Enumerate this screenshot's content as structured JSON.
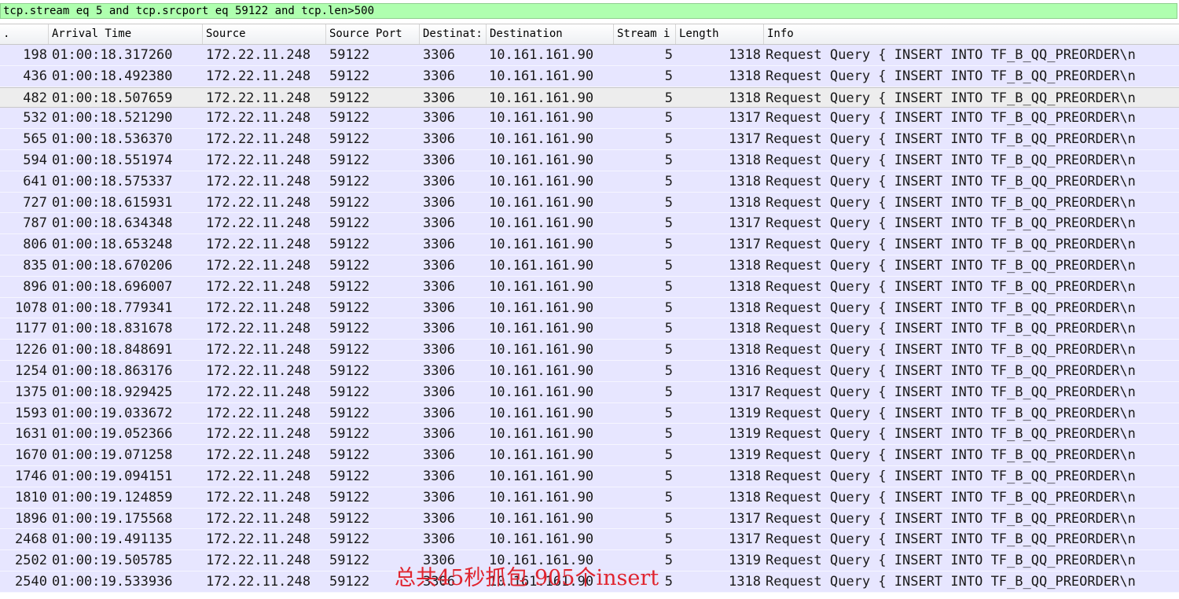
{
  "filter": {
    "text": "tcp.stream eq 5 and tcp.srcport eq 59122 and tcp.len>500"
  },
  "columns": {
    "no": ".",
    "time": "Arrival Time",
    "source": "Source",
    "source_port": "Source Port",
    "dest_port": "Destinat:",
    "destination": "Destination",
    "stream": "Stream i",
    "length": "Length",
    "info": "Info"
  },
  "selected_row_index": 2,
  "rows": [
    {
      "no": "198",
      "time": "01:00:18.317260",
      "src": "172.22.11.248",
      "sport": "59122",
      "dport": "3306",
      "dst": "10.161.161.90",
      "stream": "5",
      "len": "1318",
      "info": "Request Query { INSERT INTO TF_B_QQ_PREORDER\\n"
    },
    {
      "no": "436",
      "time": "01:00:18.492380",
      "src": "172.22.11.248",
      "sport": "59122",
      "dport": "3306",
      "dst": "10.161.161.90",
      "stream": "5",
      "len": "1318",
      "info": "Request Query { INSERT INTO TF_B_QQ_PREORDER\\n"
    },
    {
      "no": "482",
      "time": "01:00:18.507659",
      "src": "172.22.11.248",
      "sport": "59122",
      "dport": "3306",
      "dst": "10.161.161.90",
      "stream": "5",
      "len": "1318",
      "info": "Request Query { INSERT INTO TF_B_QQ_PREORDER\\n"
    },
    {
      "no": "532",
      "time": "01:00:18.521290",
      "src": "172.22.11.248",
      "sport": "59122",
      "dport": "3306",
      "dst": "10.161.161.90",
      "stream": "5",
      "len": "1317",
      "info": "Request Query { INSERT INTO TF_B_QQ_PREORDER\\n"
    },
    {
      "no": "565",
      "time": "01:00:18.536370",
      "src": "172.22.11.248",
      "sport": "59122",
      "dport": "3306",
      "dst": "10.161.161.90",
      "stream": "5",
      "len": "1317",
      "info": "Request Query { INSERT INTO TF_B_QQ_PREORDER\\n"
    },
    {
      "no": "594",
      "time": "01:00:18.551974",
      "src": "172.22.11.248",
      "sport": "59122",
      "dport": "3306",
      "dst": "10.161.161.90",
      "stream": "5",
      "len": "1318",
      "info": "Request Query { INSERT INTO TF_B_QQ_PREORDER\\n"
    },
    {
      "no": "641",
      "time": "01:00:18.575337",
      "src": "172.22.11.248",
      "sport": "59122",
      "dport": "3306",
      "dst": "10.161.161.90",
      "stream": "5",
      "len": "1318",
      "info": "Request Query { INSERT INTO TF_B_QQ_PREORDER\\n"
    },
    {
      "no": "727",
      "time": "01:00:18.615931",
      "src": "172.22.11.248",
      "sport": "59122",
      "dport": "3306",
      "dst": "10.161.161.90",
      "stream": "5",
      "len": "1318",
      "info": "Request Query { INSERT INTO TF_B_QQ_PREORDER\\n"
    },
    {
      "no": "787",
      "time": "01:00:18.634348",
      "src": "172.22.11.248",
      "sport": "59122",
      "dport": "3306",
      "dst": "10.161.161.90",
      "stream": "5",
      "len": "1317",
      "info": "Request Query { INSERT INTO TF_B_QQ_PREORDER\\n"
    },
    {
      "no": "806",
      "time": "01:00:18.653248",
      "src": "172.22.11.248",
      "sport": "59122",
      "dport": "3306",
      "dst": "10.161.161.90",
      "stream": "5",
      "len": "1317",
      "info": "Request Query { INSERT INTO TF_B_QQ_PREORDER\\n"
    },
    {
      "no": "835",
      "time": "01:00:18.670206",
      "src": "172.22.11.248",
      "sport": "59122",
      "dport": "3306",
      "dst": "10.161.161.90",
      "stream": "5",
      "len": "1318",
      "info": "Request Query { INSERT INTO TF_B_QQ_PREORDER\\n"
    },
    {
      "no": "896",
      "time": "01:00:18.696007",
      "src": "172.22.11.248",
      "sport": "59122",
      "dport": "3306",
      "dst": "10.161.161.90",
      "stream": "5",
      "len": "1318",
      "info": "Request Query { INSERT INTO TF_B_QQ_PREORDER\\n"
    },
    {
      "no": "1078",
      "time": "01:00:18.779341",
      "src": "172.22.11.248",
      "sport": "59122",
      "dport": "3306",
      "dst": "10.161.161.90",
      "stream": "5",
      "len": "1318",
      "info": "Request Query { INSERT INTO TF_B_QQ_PREORDER\\n"
    },
    {
      "no": "1177",
      "time": "01:00:18.831678",
      "src": "172.22.11.248",
      "sport": "59122",
      "dport": "3306",
      "dst": "10.161.161.90",
      "stream": "5",
      "len": "1318",
      "info": "Request Query { INSERT INTO TF_B_QQ_PREORDER\\n"
    },
    {
      "no": "1226",
      "time": "01:00:18.848691",
      "src": "172.22.11.248",
      "sport": "59122",
      "dport": "3306",
      "dst": "10.161.161.90",
      "stream": "5",
      "len": "1318",
      "info": "Request Query { INSERT INTO TF_B_QQ_PREORDER\\n"
    },
    {
      "no": "1254",
      "time": "01:00:18.863176",
      "src": "172.22.11.248",
      "sport": "59122",
      "dport": "3306",
      "dst": "10.161.161.90",
      "stream": "5",
      "len": "1316",
      "info": "Request Query { INSERT INTO TF_B_QQ_PREORDER\\n"
    },
    {
      "no": "1375",
      "time": "01:00:18.929425",
      "src": "172.22.11.248",
      "sport": "59122",
      "dport": "3306",
      "dst": "10.161.161.90",
      "stream": "5",
      "len": "1317",
      "info": "Request Query { INSERT INTO TF_B_QQ_PREORDER\\n"
    },
    {
      "no": "1593",
      "time": "01:00:19.033672",
      "src": "172.22.11.248",
      "sport": "59122",
      "dport": "3306",
      "dst": "10.161.161.90",
      "stream": "5",
      "len": "1319",
      "info": "Request Query { INSERT INTO TF_B_QQ_PREORDER\\n"
    },
    {
      "no": "1631",
      "time": "01:00:19.052366",
      "src": "172.22.11.248",
      "sport": "59122",
      "dport": "3306",
      "dst": "10.161.161.90",
      "stream": "5",
      "len": "1319",
      "info": "Request Query { INSERT INTO TF_B_QQ_PREORDER\\n"
    },
    {
      "no": "1670",
      "time": "01:00:19.071258",
      "src": "172.22.11.248",
      "sport": "59122",
      "dport": "3306",
      "dst": "10.161.161.90",
      "stream": "5",
      "len": "1319",
      "info": "Request Query { INSERT INTO TF_B_QQ_PREORDER\\n"
    },
    {
      "no": "1746",
      "time": "01:00:19.094151",
      "src": "172.22.11.248",
      "sport": "59122",
      "dport": "3306",
      "dst": "10.161.161.90",
      "stream": "5",
      "len": "1318",
      "info": "Request Query { INSERT INTO TF_B_QQ_PREORDER\\n"
    },
    {
      "no": "1810",
      "time": "01:00:19.124859",
      "src": "172.22.11.248",
      "sport": "59122",
      "dport": "3306",
      "dst": "10.161.161.90",
      "stream": "5",
      "len": "1318",
      "info": "Request Query { INSERT INTO TF_B_QQ_PREORDER\\n"
    },
    {
      "no": "1896",
      "time": "01:00:19.175568",
      "src": "172.22.11.248",
      "sport": "59122",
      "dport": "3306",
      "dst": "10.161.161.90",
      "stream": "5",
      "len": "1317",
      "info": "Request Query { INSERT INTO TF_B_QQ_PREORDER\\n"
    },
    {
      "no": "2468",
      "time": "01:00:19.491135",
      "src": "172.22.11.248",
      "sport": "59122",
      "dport": "3306",
      "dst": "10.161.161.90",
      "stream": "5",
      "len": "1317",
      "info": "Request Query { INSERT INTO TF_B_QQ_PREORDER\\n"
    },
    {
      "no": "2502",
      "time": "01:00:19.505785",
      "src": "172.22.11.248",
      "sport": "59122",
      "dport": "3306",
      "dst": "10.161.161.90",
      "stream": "5",
      "len": "1319",
      "info": "Request Query { INSERT INTO TF_B_QQ_PREORDER\\n"
    },
    {
      "no": "2540",
      "time": "01:00:19.533936",
      "src": "172.22.11.248",
      "sport": "59122",
      "dport": "3306",
      "dst": "10.161.161.90",
      "stream": "5",
      "len": "1318",
      "info": "Request Query { INSERT INTO TF_B_QQ_PREORDER\\n"
    }
  ],
  "annotation": {
    "text": "总共45秒抓包 905个insert",
    "color": "#e0242e"
  },
  "colors": {
    "row_bg": "#e7e6ff",
    "selected_bg": "#ededed",
    "filter_bg": "#afffaf"
  }
}
